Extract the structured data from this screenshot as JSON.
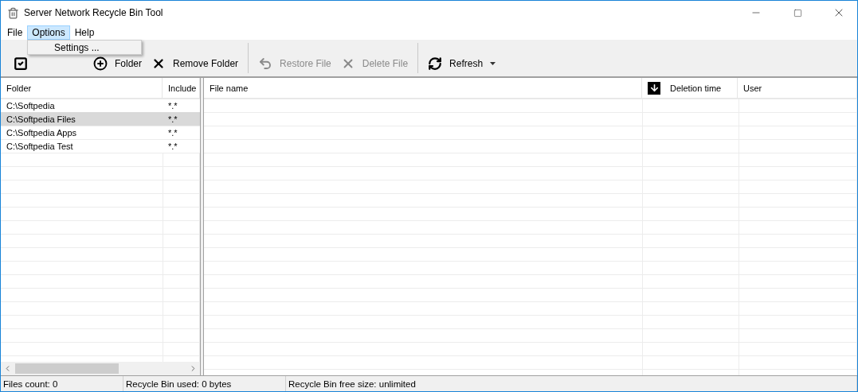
{
  "window": {
    "title": "Server Network Recycle Bin Tool"
  },
  "menu": [
    {
      "label": "File",
      "selected": false
    },
    {
      "label": "Options",
      "selected": true
    },
    {
      "label": "Help",
      "selected": false
    }
  ],
  "dropdown": {
    "items": [
      "Settings ..."
    ]
  },
  "toolbar": [
    {
      "disabled": false,
      "separator_after": false,
      "has_menu": false
    },
    {
      "label": "Folder",
      "disabled": false,
      "separator_after": false,
      "has_menu": false
    },
    {
      "label": "Remove Folder",
      "disabled": false,
      "separator_after": true,
      "has_menu": false
    },
    {
      "label": "Restore File",
      "disabled": true,
      "separator_after": false,
      "has_menu": false
    },
    {
      "label": "Delete File",
      "disabled": true,
      "separator_after": true,
      "has_menu": false
    },
    {
      "label": "Refresh",
      "disabled": false,
      "separator_after": false,
      "has_menu": true
    }
  ],
  "folders": {
    "columns": [
      "Folder",
      "Include"
    ],
    "rows": [
      {
        "folder": "C:\\Softpedia",
        "include": "*.*",
        "selected": false
      },
      {
        "folder": "C:\\Softpedia Files",
        "include": "*.*",
        "selected": true
      },
      {
        "folder": "C:\\Softpedia Apps",
        "include": "*.*",
        "selected": false
      },
      {
        "folder": "C:\\Softpedia Test",
        "include": "*.*",
        "selected": false
      }
    ]
  },
  "files": {
    "columns": [
      {
        "label": "File name",
        "sorted": false
      },
      {
        "label": "Deletion time",
        "sorted": true
      },
      {
        "label": "User",
        "sorted": false
      }
    ]
  },
  "status_bar": [
    "Files count: 0",
    "Recycle Bin used: 0 bytes",
    "Recycle Bin free size: unlimited"
  ]
}
